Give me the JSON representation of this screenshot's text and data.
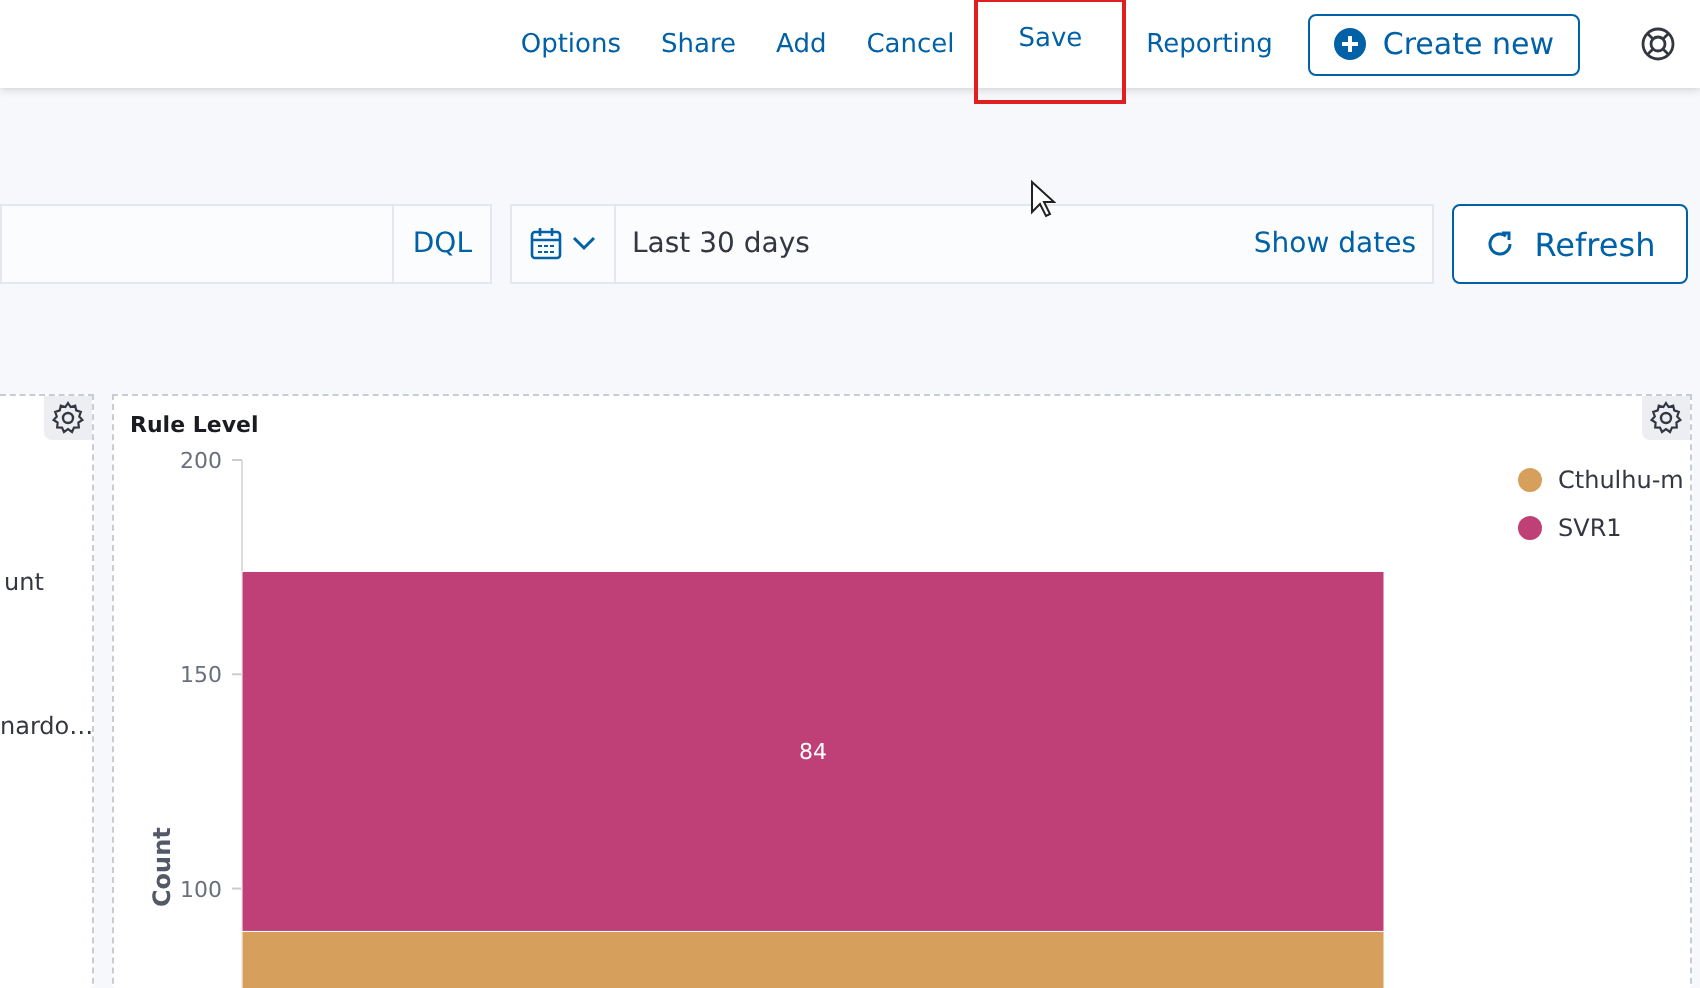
{
  "top_nav": {
    "links": [
      {
        "label": "Options",
        "highlighted": false
      },
      {
        "label": "Share",
        "highlighted": false
      },
      {
        "label": "Add",
        "highlighted": false
      },
      {
        "label": "Cancel",
        "highlighted": false
      },
      {
        "label": "Save",
        "highlighted": true
      },
      {
        "label": "Reporting",
        "highlighted": false
      }
    ],
    "create_button": "Create new"
  },
  "query_bar": {
    "language_button": "DQL",
    "date_range": "Last 30 days",
    "show_dates": "Show dates",
    "refresh_button": "Refresh"
  },
  "left_panel": {
    "texts": [
      "unt",
      "nardo…"
    ]
  },
  "rule_level_panel": {
    "title": "Rule Level",
    "chart_data": {
      "type": "bar",
      "stacked": true,
      "ylabel": "Count",
      "categories": [
        null
      ],
      "ylim": [
        60,
        200
      ],
      "yticks": [
        100,
        150,
        200
      ],
      "value_labels": [
        [
          null
        ],
        [
          "84"
        ]
      ],
      "series": [
        {
          "name": "Cthulhu-m",
          "color": "#d6a05c",
          "values": [
            90
          ]
        },
        {
          "name": "SVR1",
          "color": "#bf4077",
          "values": [
            84
          ]
        }
      ]
    }
  }
}
